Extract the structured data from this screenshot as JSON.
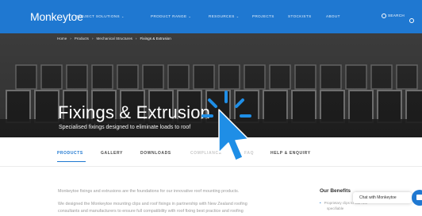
{
  "nav": {
    "logo": "Monkeytoe",
    "items": [
      {
        "label": "PROJECT SOLUTIONS",
        "has_dropdown": true
      },
      {
        "label": "PRODUCT RANGE",
        "has_dropdown": true
      },
      {
        "label": "RESOURCES",
        "has_dropdown": true
      },
      {
        "label": "PROJECTS",
        "has_dropdown": false
      },
      {
        "label": "STOCKISTS",
        "has_dropdown": false
      },
      {
        "label": "ABOUT",
        "has_dropdown": false
      }
    ],
    "search_label": "SEARCH"
  },
  "breadcrumb": [
    "Home",
    "Products",
    "Mechanical Structures",
    "Fixings & Extrusion"
  ],
  "hero": {
    "title": "Fixings & Extrusion",
    "subtitle": "Specialised fixings designed to eliminate loads to roof"
  },
  "tabs": [
    {
      "label": "PRODUCTS",
      "active": true
    },
    {
      "label": "GALLERY",
      "active": false
    },
    {
      "label": "DOWNLOADS",
      "active": false
    },
    {
      "label": "COMPLIANCE",
      "active": false
    },
    {
      "label": "FAQ",
      "active": false
    },
    {
      "label": "HELP & ENQUIRY",
      "active": false
    }
  ],
  "body": {
    "paragraph_1": "Monkeytoe fixings and extrusions are the foundations for our innovative roof mounting products.",
    "paragraph_2_line_1": "We designed the Monkeytoe mounting clips and roof fixings in partnership with New Zealand roofing",
    "paragraph_2_line_2": "consultants and manufacturers to ensure full compatibility with roof fixing best practice and roofing"
  },
  "benefits": {
    "title": "Our Benefits",
    "items": [
      {
        "line_1": "Proprietary clips to suit roof",
        "line_2": "specifiable"
      }
    ]
  },
  "chat": {
    "label": "Chat with Monkeytoe"
  },
  "colors": {
    "brand_blue": "#1f78d1",
    "hero_dark": "#2b2b2b"
  }
}
